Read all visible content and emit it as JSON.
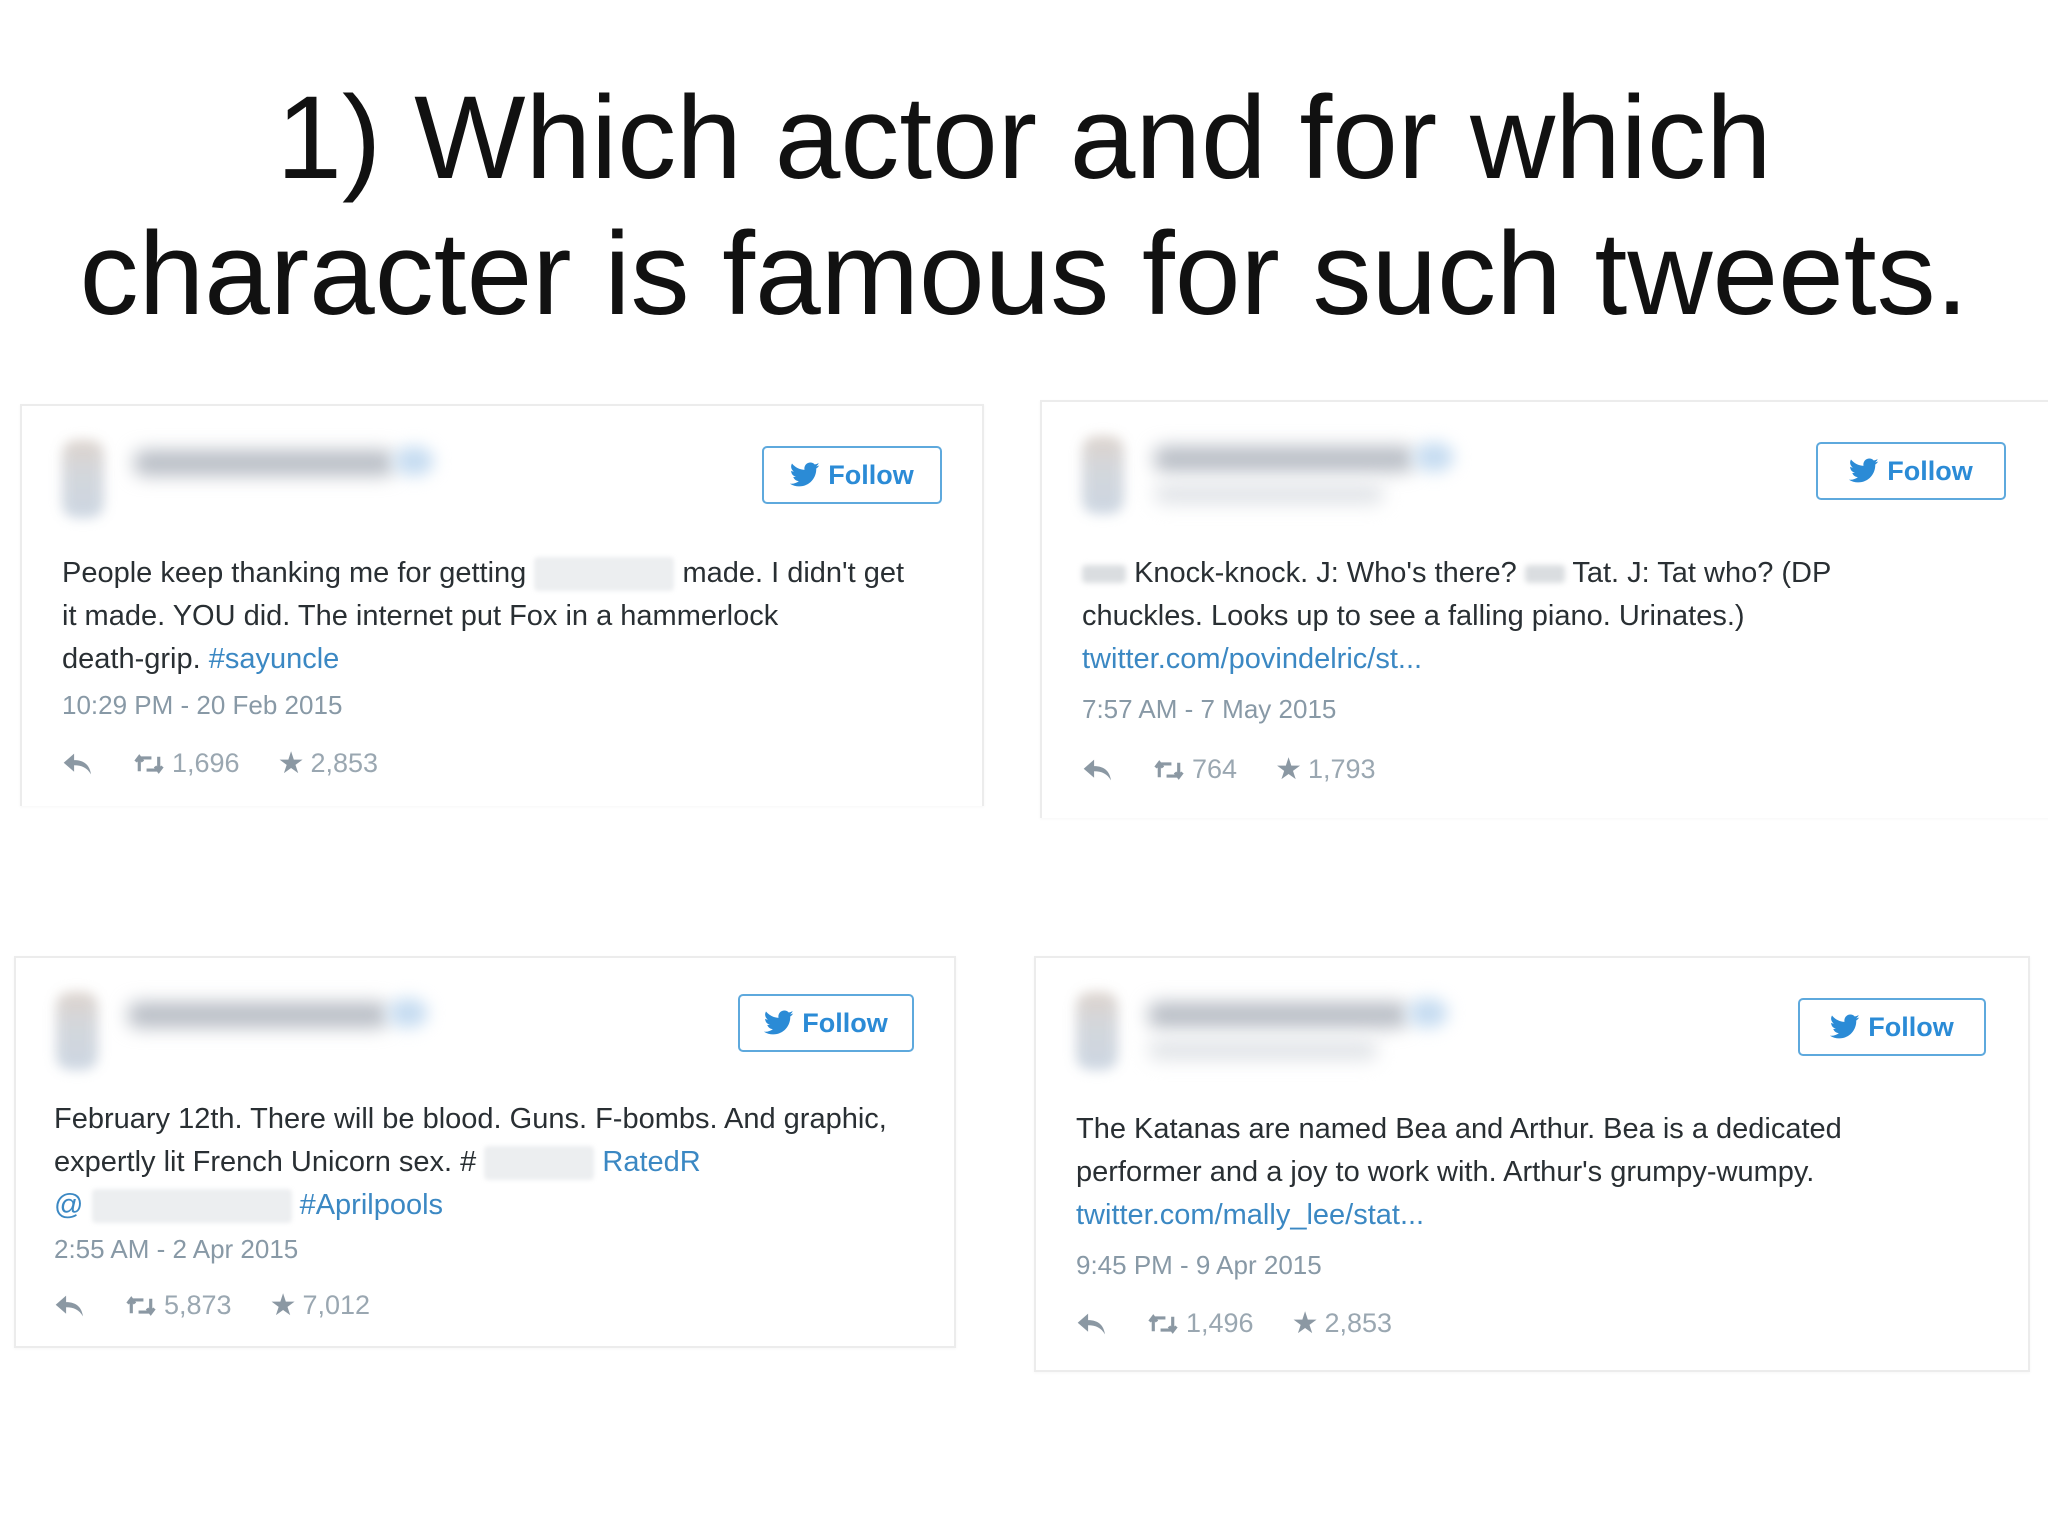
{
  "title": {
    "line1": "1) Which actor and for which",
    "line2": "character is famous for such tweets."
  },
  "follow_label": "Follow",
  "tweets": [
    {
      "lines": {
        "l1a": "People keep thanking me for getting",
        "l1b": "made. I didn't get",
        "l2": "it made. YOU did. The internet put Fox in a hammerlock",
        "l3": "death-grip.",
        "hashtag": "#sayuncle"
      },
      "timestamp": "10:29 PM - 20 Feb 2015",
      "retweets": "1,696",
      "favorites": "2,853"
    },
    {
      "lines": {
        "l1a": "Knock-knock. J: Who's there?",
        "l1b": "Tat. J: Tat who? (DP",
        "l2": "chuckles. Looks up to see a falling piano. Urinates.)",
        "link": "twitter.com/povindelric/st..."
      },
      "timestamp": "7:57 AM - 7 May 2015",
      "retweets": "764",
      "favorites": "1,793"
    },
    {
      "lines": {
        "l1": "February 12th. There will be blood. Guns. F-bombs. And graphic,",
        "l2a": "expertly lit French Unicorn sex. #",
        "l2b": "RatedR",
        "l3a": "@",
        "l3b": "#Aprilpools"
      },
      "timestamp": "2:55 AM - 2 Apr 2015",
      "retweets": "5,873",
      "favorites": "7,012"
    },
    {
      "lines": {
        "l1": "The Katanas are named Bea and Arthur. Bea is a dedicated",
        "l2": "performer and a joy to work with. Arthur's grumpy-wumpy.",
        "link": "twitter.com/mally_lee/stat..."
      },
      "timestamp": "9:45 PM - 9 Apr 2015",
      "retweets": "1,496",
      "favorites": "2,853"
    }
  ],
  "icons": {
    "bird": "twitter-bird-icon",
    "reply": "reply-icon",
    "retweet": "retweet-icon",
    "favorite": "star-icon"
  },
  "colors": {
    "follow_blue": "#2b8bd6",
    "link_blue": "#3b88c3",
    "meta_gray": "#8899a6"
  }
}
